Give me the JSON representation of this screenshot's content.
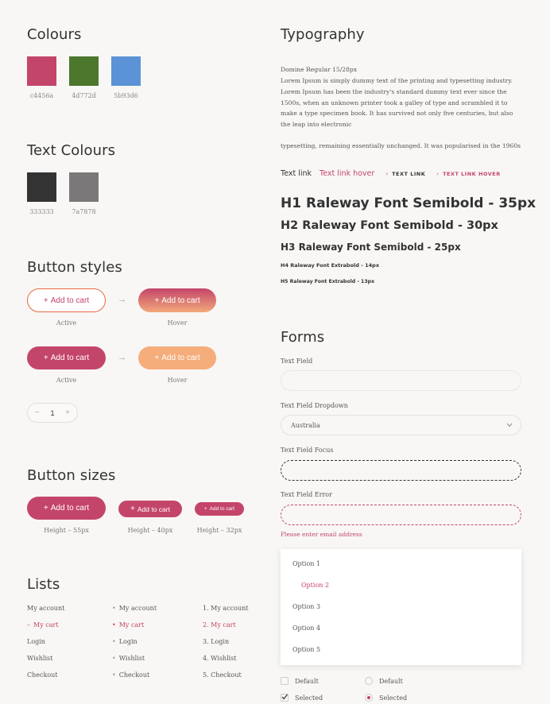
{
  "colours": {
    "title": "Colours",
    "swatches": [
      {
        "hex": "#c4456a",
        "label": "c4456a"
      },
      {
        "hex": "#4d772d",
        "label": "4d772d"
      },
      {
        "hex": "#5b93d6",
        "label": "5b93d6"
      }
    ]
  },
  "text_colours": {
    "title": "Text Colours",
    "swatches": [
      {
        "hex": "#333333",
        "label": "333333"
      },
      {
        "hex": "#7a7878",
        "label": "7a7878"
      }
    ]
  },
  "button_styles": {
    "title": "Button styles",
    "label": "Add to cart",
    "plus": "+",
    "arrow": "→",
    "row1": {
      "left_caption": "Active",
      "right_caption": "Hover"
    },
    "row2": {
      "left_caption": "Active",
      "right_caption": "Hover"
    },
    "stepper": {
      "minus": "−",
      "value": "1",
      "plus": "+"
    },
    "colors": {
      "primary": "#c4456a",
      "hover_gradient_start": "#c4456a",
      "hover_gradient_end": "#f2a97a",
      "peach": "#f5ad7b",
      "outline": "#e8683f"
    }
  },
  "button_sizes": {
    "title": "Button sizes",
    "label": "Add to cart",
    "plus": "+",
    "captions": [
      "Height – 55px",
      "Height – 40px",
      "Height – 32px"
    ]
  },
  "lists": {
    "title": "Lists",
    "plain": [
      "My account",
      "My cart",
      "Login",
      "Wishlist",
      "Checkout"
    ],
    "bulleted": [
      "My account",
      "My cart",
      "Login",
      "Wishlist",
      "Checkout"
    ],
    "numbered": [
      "1. My account",
      "2. My cart",
      "3. Login",
      "4. Wishlist",
      "5. Checkout"
    ],
    "selected_index": 1,
    "bullet": "•",
    "selected_marker": "–"
  },
  "typography": {
    "title": "Typography",
    "spec": "Domine Regular 15/28px",
    "paragraph1": "Lorem Ipsum is simply dummy text of the printing and typesetting industry. Lorem Ipsum has been the industry's standard dummy text ever since the 1500s, when an unknown printer took a galley of type and scrambled it to make a type specimen book. It has survived not only five centuries, but also the leap into electronic",
    "paragraph2": "typesetting, remaining essentially unchanged. It was popularised in the 1960s",
    "links": {
      "text_link": "Text link",
      "text_link_hover": "Text link hover",
      "caps_link": "TEXT LINK",
      "caps_link_hover": "TEXT LINK HOVER",
      "marker": "‹"
    },
    "headings": {
      "h1": "H1 Raleway Font Semibold - 35px",
      "h2": "H2 Raleway Font Semibold - 30px",
      "h3": "H3 Raleway Font Semibold - 25px",
      "h4": "H4 Raleway Font Extrabold - 14px",
      "h5": "H5 Raleway Font Extrabold - 13px"
    }
  },
  "forms": {
    "title": "Forms",
    "text_field_label": "Text Field",
    "dropdown_label": "Text Field Dropdown",
    "dropdown_value": "Australia",
    "focus_label": "Text Field Focus",
    "error_label": "Text Field Error",
    "error_message": "Please enter email address",
    "options": [
      "Option 1",
      "Option 2",
      "Option 3",
      "Option 4",
      "Option 5"
    ],
    "selected_option": 1,
    "checkbox_default": "Default",
    "checkbox_selected": "Selected",
    "radio_default": "Default",
    "radio_selected": "Selected"
  }
}
